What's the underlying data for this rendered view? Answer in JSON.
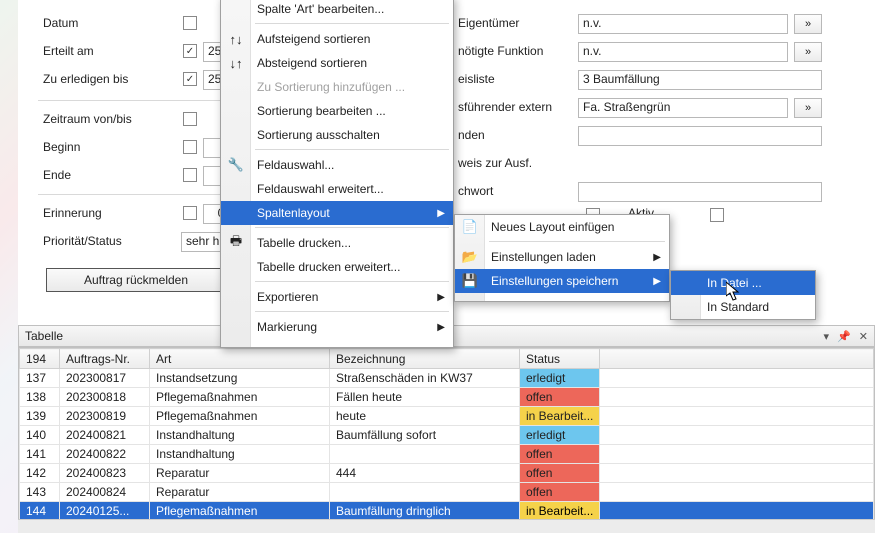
{
  "form": {
    "datum": "Datum",
    "erteilt_am": "Erteilt am",
    "erteilt_am_value": "25.",
    "zu_erledigen_bis": "Zu erledigen bis",
    "zu_erledigen_bis_value": "25.",
    "zeitraum": "Zeitraum von/bis",
    "beginn": "Beginn",
    "ende": "Ende",
    "erinnerung": "Erinnerung",
    "erinnerung_value": "0",
    "prioritaet": "Priorität/Status",
    "prioritaet_value": "sehr h",
    "eigentuemer": "Eigentümer",
    "eigentuemer_value": "n.v.",
    "funktion": "nötigte Funktion",
    "funktion_value": "n.v.",
    "preisliste": "eisliste",
    "preisliste_value": "3 Baumfällung",
    "ausfuehrender": "sführender extern",
    "ausfuehrender_value": "Fa. Straßengrün",
    "nden": "nden",
    "hinweis": "weis zur Ausf.",
    "chwort": "chwort",
    "aktiv": "Aktiv",
    "rueckmelden": "Auftrag rückmelden"
  },
  "menu1": {
    "items": [
      {
        "label": "Spalte 'Art' bearbeiten...",
        "icon": ""
      },
      {
        "sep": true
      },
      {
        "label": "Aufsteigend sortieren",
        "icon": "↑↓"
      },
      {
        "label": "Absteigend sortieren",
        "icon": "↓↑"
      },
      {
        "label": "Zu Sortierung hinzufügen ...",
        "icon": "",
        "disabled": true
      },
      {
        "label": "Sortierung bearbeiten ...",
        "icon": ""
      },
      {
        "label": "Sortierung ausschalten",
        "icon": ""
      },
      {
        "sep": true
      },
      {
        "label": "Feldauswahl...",
        "icon": "🔧"
      },
      {
        "label": "Feldauswahl erweitert...",
        "icon": ""
      },
      {
        "label": "Spaltenlayout",
        "icon": "",
        "hovered": true,
        "arrow": true
      },
      {
        "sep": true
      },
      {
        "label": "Tabelle drucken...",
        "icon": "🖶"
      },
      {
        "label": "Tabelle drucken erweitert...",
        "icon": ""
      },
      {
        "sep": true
      },
      {
        "label": "Exportieren",
        "icon": "",
        "arrow": true
      },
      {
        "sep": true
      },
      {
        "label": "Markierung",
        "icon": "",
        "arrow": true
      }
    ]
  },
  "menu2": {
    "items": [
      {
        "label": "Neues Layout einfügen",
        "icon": "📄"
      },
      {
        "sep": true
      },
      {
        "label": "Einstellungen laden",
        "icon": "📂",
        "arrow": true
      },
      {
        "label": "Einstellungen speichern",
        "icon": "💾",
        "hovered": true,
        "arrow": true
      }
    ]
  },
  "menu3": {
    "items": [
      {
        "label": "In Datei ...",
        "hovered": true
      },
      {
        "label": "In Standard"
      }
    ]
  },
  "tabelle": {
    "title": "Tabelle",
    "columns": [
      "194",
      "Auftrags-Nr.",
      "Art",
      "Bezeichnung",
      "Status"
    ],
    "rows": [
      {
        "n": "137",
        "auf": "202300817",
        "art": "Instandsetzung",
        "bez": "Straßenschäden in KW37",
        "stat": "erledigt",
        "cls": "status-erledigt"
      },
      {
        "n": "138",
        "auf": "202300818",
        "art": "Pflegemaßnahmen",
        "bez": "Fällen heute",
        "stat": "offen",
        "cls": "status-offen"
      },
      {
        "n": "139",
        "auf": "202300819",
        "art": "Pflegemaßnahmen",
        "bez": "heute",
        "stat": "in Bearbeit...",
        "cls": "status-bearb"
      },
      {
        "n": "140",
        "auf": "202400821",
        "art": "Instandhaltung",
        "bez": "Baumfällung sofort",
        "stat": "erledigt",
        "cls": "status-erledigt"
      },
      {
        "n": "141",
        "auf": "202400822",
        "art": "Instandhaltung",
        "bez": "",
        "stat": "offen",
        "cls": "status-offen"
      },
      {
        "n": "142",
        "auf": "202400823",
        "art": "Reparatur",
        "bez": "444",
        "stat": "offen",
        "cls": "status-offen"
      },
      {
        "n": "143",
        "auf": "202400824",
        "art": "Reparatur",
        "bez": "",
        "stat": "offen",
        "cls": "status-offen"
      },
      {
        "n": "144",
        "auf": "20240125...",
        "art": "Pflegemaßnahmen",
        "bez": "Baumfällung dringlich",
        "stat": "in Bearbeit...",
        "cls": "status-bearb",
        "selected": true
      }
    ]
  }
}
